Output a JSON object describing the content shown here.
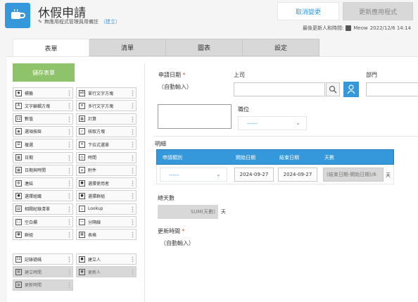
{
  "app": {
    "title": "休假申請",
    "subtitle": "無應用程式管理員用備註",
    "subtitle_link": "（建立）",
    "cancel_label": "取消變更",
    "update_label": "更新應用程式",
    "last_update_label": "最後更新人和時間:",
    "last_update_user": "Meow",
    "last_update_time": "2022/12/6 14:14"
  },
  "tabs": [
    {
      "label": "表單",
      "active": true
    },
    {
      "label": "清單",
      "active": false
    },
    {
      "label": "圖表",
      "active": false
    },
    {
      "label": "設定",
      "active": false
    }
  ],
  "save_form_label": "儲存表單",
  "palette": [
    {
      "label": "標籤",
      "icon": "tag-icon",
      "glyph": "◆"
    },
    {
      "label": "單行文字方塊",
      "icon": "single-line-text-icon",
      "glyph": "ab"
    },
    {
      "label": "文字編輯方塊",
      "icon": "rich-text-icon",
      "glyph": "A"
    },
    {
      "label": "多行文字方塊",
      "icon": "multi-line-text-icon",
      "glyph": "≡"
    },
    {
      "label": "數值",
      "icon": "number-icon",
      "glyph": "12"
    },
    {
      "label": "計算",
      "icon": "calc-icon",
      "glyph": "▦"
    },
    {
      "label": "選項按鈕",
      "icon": "radio-icon",
      "glyph": "◉"
    },
    {
      "label": "核取方塊",
      "icon": "checkbox-icon",
      "glyph": "✓"
    },
    {
      "label": "複選",
      "icon": "multi-select-icon",
      "glyph": "☰"
    },
    {
      "label": "下拉式選單",
      "icon": "dropdown-icon",
      "glyph": "▾"
    },
    {
      "label": "日期",
      "icon": "date-icon",
      "glyph": "▦"
    },
    {
      "label": "時間",
      "icon": "clock-icon",
      "glyph": "◷"
    },
    {
      "label": "日期與時間",
      "icon": "datetime-icon",
      "glyph": "▦"
    },
    {
      "label": "附件",
      "icon": "attachment-icon",
      "glyph": "⌀"
    },
    {
      "label": "連結",
      "icon": "link-icon",
      "glyph": "◍"
    },
    {
      "label": "選擇使用者",
      "icon": "user-select-icon",
      "glyph": "●"
    },
    {
      "label": "選擇組織",
      "icon": "org-select-icon",
      "glyph": "●"
    },
    {
      "label": "選擇群組",
      "icon": "group-select-icon",
      "glyph": "●"
    },
    {
      "label": "相關紀錄清單",
      "icon": "related-records-icon",
      "glyph": "▤"
    },
    {
      "label": "Lookup",
      "icon": "lookup-icon",
      "glyph": "⌕"
    },
    {
      "label": "空白欄",
      "icon": "space-icon",
      "glyph": "□"
    },
    {
      "label": "分隔線",
      "icon": "divider-icon",
      "glyph": "—"
    },
    {
      "label": "群組",
      "icon": "group-icon",
      "glyph": "▣"
    },
    {
      "label": "表格",
      "icon": "table-icon",
      "glyph": "▦"
    }
  ],
  "system_fields": [
    {
      "label": "記錄號碼",
      "icon": "record-number-icon",
      "glyph": "12",
      "gray": false
    },
    {
      "label": "建立人",
      "icon": "creator-icon",
      "glyph": "●",
      "gray": false
    },
    {
      "label": "建立時間",
      "icon": "created-time-icon",
      "glyph": "▦",
      "gray": true
    },
    {
      "label": "更新人",
      "icon": "updater-icon",
      "glyph": "●",
      "gray": true
    },
    {
      "label": "更新時間",
      "icon": "updated-time-icon",
      "glyph": "▦",
      "gray": true
    }
  ],
  "form": {
    "apply_date_label": "申請日期",
    "auto_input": "（自動輸入）",
    "supervisor_label": "上司",
    "department_label": "部門",
    "position_label": "職位",
    "dropdown_placeholder": "-----",
    "details_label": "明細",
    "table_headers": [
      "申請類別",
      "開始日期",
      "結束日期",
      "天數"
    ],
    "row": {
      "category": "-----",
      "start_date": "2024-09-27",
      "end_date": "2024-09-27",
      "days_formula": "(結束日期-開始日期)/6",
      "days_unit": "天"
    },
    "total_days_label": "總天數",
    "total_days_formula": "SUM(天數)",
    "total_days_unit": "天",
    "updated_time_label": "更新時間",
    "updated_time_auto": "（自動輸入）"
  },
  "colors": {
    "accent": "#3498db",
    "save_green": "#8fc36b",
    "required": "#e74c3c"
  }
}
